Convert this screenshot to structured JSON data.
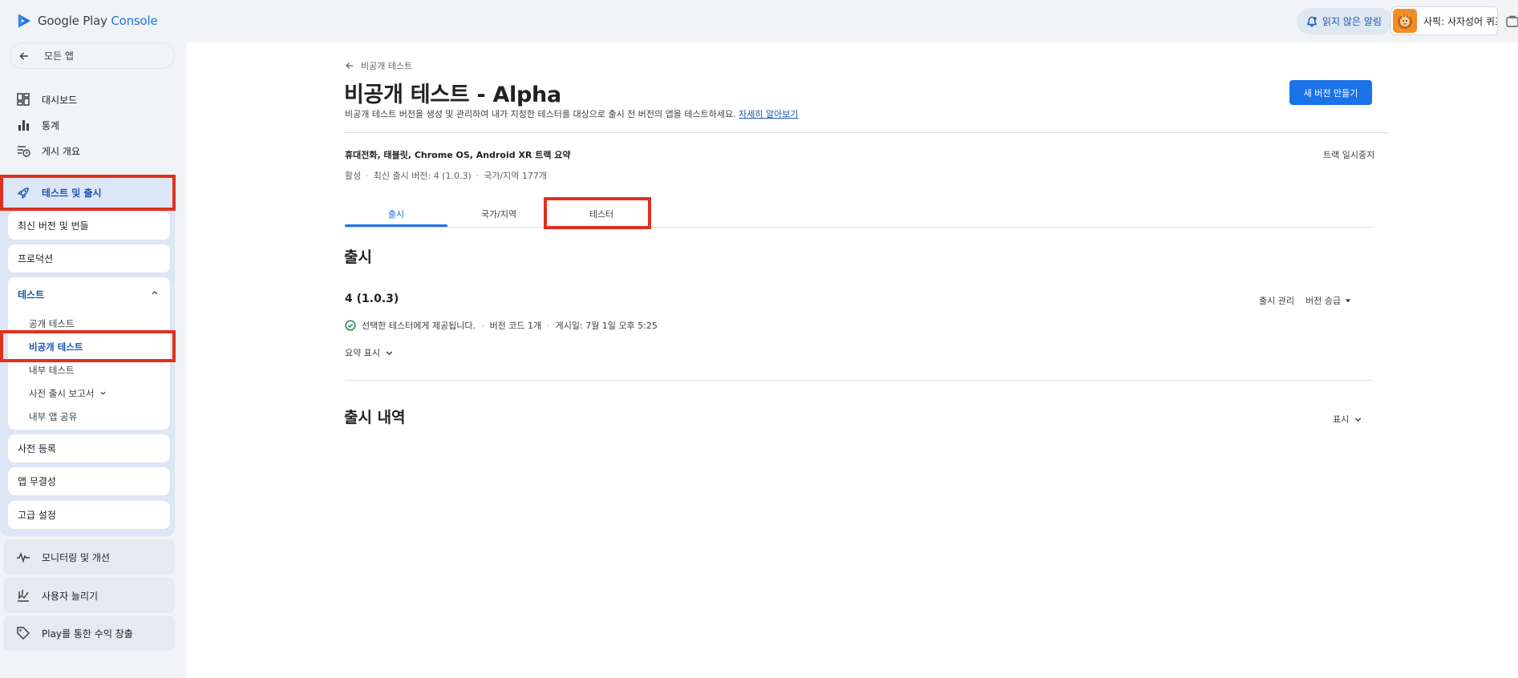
{
  "header": {
    "logo_prefix": "Google Play",
    "logo_suffix": "Console",
    "notifications_label": "읽지 않은 알림",
    "app_name": "사픽: 사자성어 퀴즈"
  },
  "sidebar": {
    "back_label": "모든 앱",
    "items": [
      {
        "label": "대시보드",
        "icon": "dashboard-icon"
      },
      {
        "label": "통계",
        "icon": "bar-chart-icon"
      },
      {
        "label": "게시 개요",
        "icon": "publishing-overview-icon"
      }
    ],
    "active_section": {
      "label": "테스트 및 출시",
      "icon": "rocket-icon"
    },
    "sub_sections": {
      "latest": "최신 버전 및 번들",
      "production": "프로덕션",
      "testing": {
        "label": "테스트",
        "children": [
          "공개 테스트",
          "비공개 테스트",
          "내부 테스트",
          "사전 출시 보고서",
          "내부 앱 공유"
        ]
      },
      "pre_registration": "사전 등록",
      "integrity": "앱 무결성",
      "advanced": "고급 설정"
    },
    "lower": [
      {
        "label": "모니터링 및 개선",
        "icon": "monitoring-icon"
      },
      {
        "label": "사용자 늘리기",
        "icon": "grow-users-icon"
      },
      {
        "label": "Play를 통한 수익 창출",
        "icon": "tag-icon"
      }
    ]
  },
  "main": {
    "breadcrumb": "비공개 테스트",
    "title": "비공개 테스트 - Alpha",
    "subtitle": "비공개 테스트 버전을 생성 및 관리하여 내가 지정한 테스터를 대상으로 출시 전 버전의 앱을 테스트하세요.",
    "learn_more": "자세히 알아보기",
    "create_button": "새 버전 만들기",
    "track_summary": "휴대전화, 태블릿, Chrome OS, Android XR 트랙 요약",
    "pause_track": "트랙 일시중지",
    "status": "활성",
    "latest_release": "최신 출시 버전: 4 (1.0.3)",
    "countries": "국가/지역 177개",
    "tabs": [
      "출시",
      "국가/지역",
      "테스터"
    ],
    "active_tab": "출시",
    "release_section_title": "출시",
    "release": {
      "name": "4 (1.0.3)",
      "manage": "출시 관리",
      "promote": "버전 승급",
      "status_text": "선택한 테스터에게 제공됩니다.",
      "version_codes": "버전 코드 1개",
      "published": "게시일: 7월 1일 오후 5:25",
      "show_summary": "요약 표시"
    },
    "history_title": "출시 내역",
    "show_label": "표시"
  },
  "colors": {
    "accent": "#1a73e8",
    "annotation_red": "#e0301e",
    "sidebar_bg": "#f1f3f6",
    "active_bg": "#dce6f6"
  }
}
